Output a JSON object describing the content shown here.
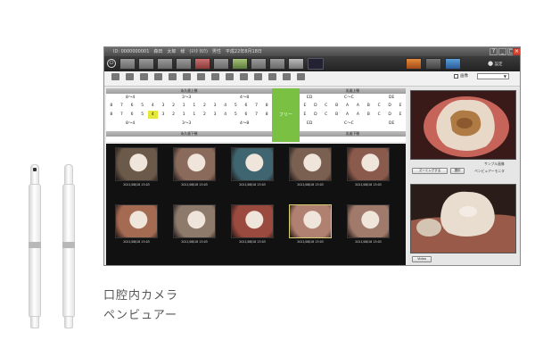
{
  "caption": {
    "line1": "口腔内カメラ",
    "line2": "ペンビュアー"
  },
  "window": {
    "title": "ID: 0000000001　森田　太郎　様　(ﾓﾘﾀ ﾀﾛｳ)　男性　平成22年8月18日",
    "controls": [
      "?",
      "_",
      "□",
      "×"
    ]
  },
  "toolbar": {
    "items": [
      "",
      "",
      "",
      "",
      "",
      "",
      "",
      "",
      "",
      "",
      ""
    ],
    "right_label": "設定"
  },
  "toolbar2": {
    "items": [
      "",
      "",
      "",
      "",
      "",
      "",
      "",
      "",
      "",
      "",
      "",
      "",
      "",
      ""
    ],
    "checkbox_label": "画像",
    "select_value": ""
  },
  "dental_chart": {
    "upper_permanent_label": "永久歯上顎",
    "upper_deciduous_label": "乳歯上顎",
    "lower_permanent_label": "永久歯下顎",
    "lower_deciduous_label": "乳歯下顎",
    "quadrants_top": [
      "8〜4",
      "3〜3",
      "4〜8"
    ],
    "quadrants_top_deciduous": [
      "ED",
      "C〜C",
      "DE"
    ],
    "quadrants_bottom": [
      "8〜4",
      "3〜3",
      "4〜8"
    ],
    "quadrants_bottom_deciduous": [
      "ED",
      "C〜C",
      "DE"
    ],
    "upper_row": [
      "8",
      "7",
      "6",
      "5",
      "4",
      "3",
      "2",
      "1",
      "1",
      "2",
      "3",
      "4",
      "5",
      "6",
      "7",
      "8"
    ],
    "lower_row": [
      "8",
      "7",
      "6",
      "5",
      "4",
      "3",
      "2",
      "1",
      "1",
      "2",
      "3",
      "4",
      "5",
      "6",
      "7",
      "8"
    ],
    "upper_deciduous_row": [
      "E",
      "D",
      "C",
      "B",
      "A",
      "A",
      "B",
      "C",
      "D",
      "E"
    ],
    "lower_deciduous_row": [
      "E",
      "D",
      "C",
      "B",
      "A",
      "A",
      "B",
      "C",
      "D",
      "E"
    ],
    "free_label": "フリー"
  },
  "thumbnails": [
    {
      "date": "2011/08/18 13:03",
      "tone": "#6b5a4a"
    },
    {
      "date": "2011/08/18 13:03",
      "tone": "#8a6a5a"
    },
    {
      "date": "2011/08/18 13:03",
      "tone": "#3f6570"
    },
    {
      "date": "2011/08/18 13:03",
      "tone": "#7a6050"
    },
    {
      "date": "2011/08/18 13:03",
      "tone": "#8a5a4c"
    },
    {
      "date": "2011/08/18 13:03",
      "tone": "#a56b52"
    },
    {
      "date": "2011/08/18 13:03",
      "tone": "#8d7a6a"
    },
    {
      "date": "2011/08/18 13:03",
      "tone": "#9a4a3f"
    },
    {
      "date": "2011/08/18 13:03",
      "tone": "#b08070"
    },
    {
      "date": "2011/08/18 13:03",
      "tone": "#a07a6a"
    }
  ],
  "right_panel": {
    "sample_label": "サンプル画像",
    "zoom_button": "ズーミングする",
    "select_button": "選択",
    "live_label": "ペンビュアーモニタ",
    "video_button": "Video"
  },
  "colors": {
    "accent_green": "#7ac143",
    "selected_tooth": "#e3e83a",
    "close_red": "#d9442e"
  }
}
